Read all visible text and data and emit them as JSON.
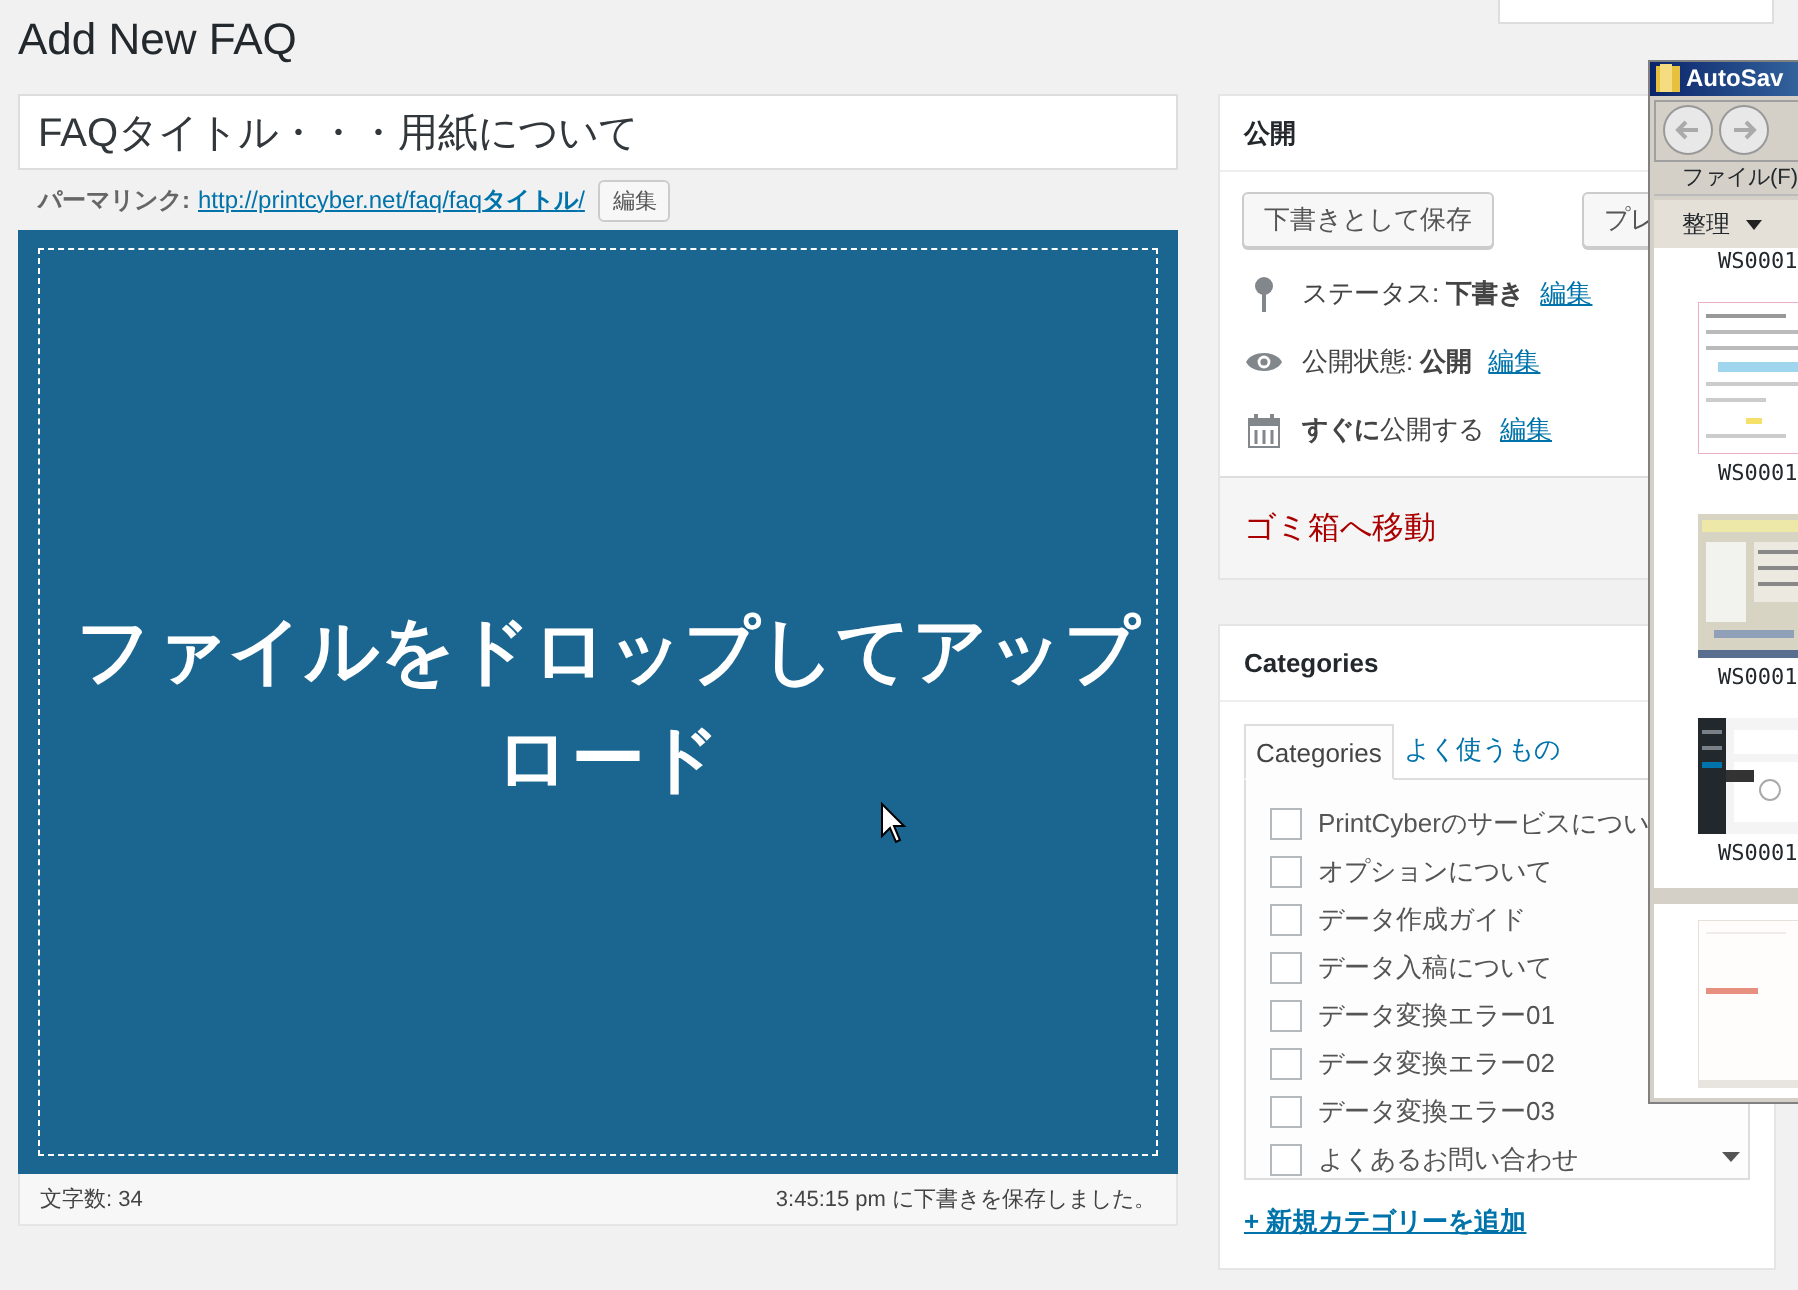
{
  "page_title": "Add New FAQ",
  "title_field": {
    "value": "FAQタイトル・・・用紙について"
  },
  "permalink": {
    "label": "パーマリンク:",
    "url": "http://printcyber.net/faq/faq**タイトル**/",
    "edit_button": "編集"
  },
  "editor": {
    "drop_message": "ファイルをドロップしてアップロード",
    "word_count": "文字数: 34",
    "save_status": "3:45:15 pm に下書きを保存しました。"
  },
  "publish": {
    "title": "公開",
    "buttons": [
      {
        "label": "下書きとして保存"
      },
      {
        "label": "プレ"
      }
    ],
    "rows": [
      {
        "kind": "status",
        "text": "ステータス: **下書き**",
        "link": "編集"
      },
      {
        "kind": "visibility",
        "text": "公開状態: **公開**",
        "link": "編集"
      },
      {
        "kind": "schedule",
        "text": "**すぐに**公開する",
        "link": "編集"
      }
    ],
    "trash_link": "ゴミ箱へ移動"
  },
  "categories": {
    "title": "Categories",
    "tabs": [
      {
        "label": "Categories",
        "selected": true
      },
      {
        "label": "よく使うもの",
        "selected": false
      }
    ],
    "items": [
      {
        "label": "PrintCyberのサービスについ",
        "checked": false
      },
      {
        "label": "オプションについて",
        "checked": false
      },
      {
        "label": "データ作成ガイド",
        "checked": false
      },
      {
        "label": "データ入稿について",
        "checked": false
      },
      {
        "label": "データ変換エラー01",
        "checked": false
      },
      {
        "label": "データ変換エラー02",
        "checked": false
      },
      {
        "label": "データ変換エラー03",
        "checked": false
      },
      {
        "label": "よくあるお問い合わせ",
        "checked": false
      }
    ],
    "add_link": "+ 新規カテゴリーを追加"
  },
  "explorer": {
    "title": "AutoSav",
    "menu": "ファイル(F)",
    "organize": "整理",
    "files": [
      {
        "label": "WS0001",
        "kind": "label-only"
      },
      {
        "label": "WS0001",
        "kind": "light"
      },
      {
        "label": "WS0001",
        "kind": "form"
      },
      {
        "label": "WS0001",
        "kind": "dark"
      }
    ]
  }
}
